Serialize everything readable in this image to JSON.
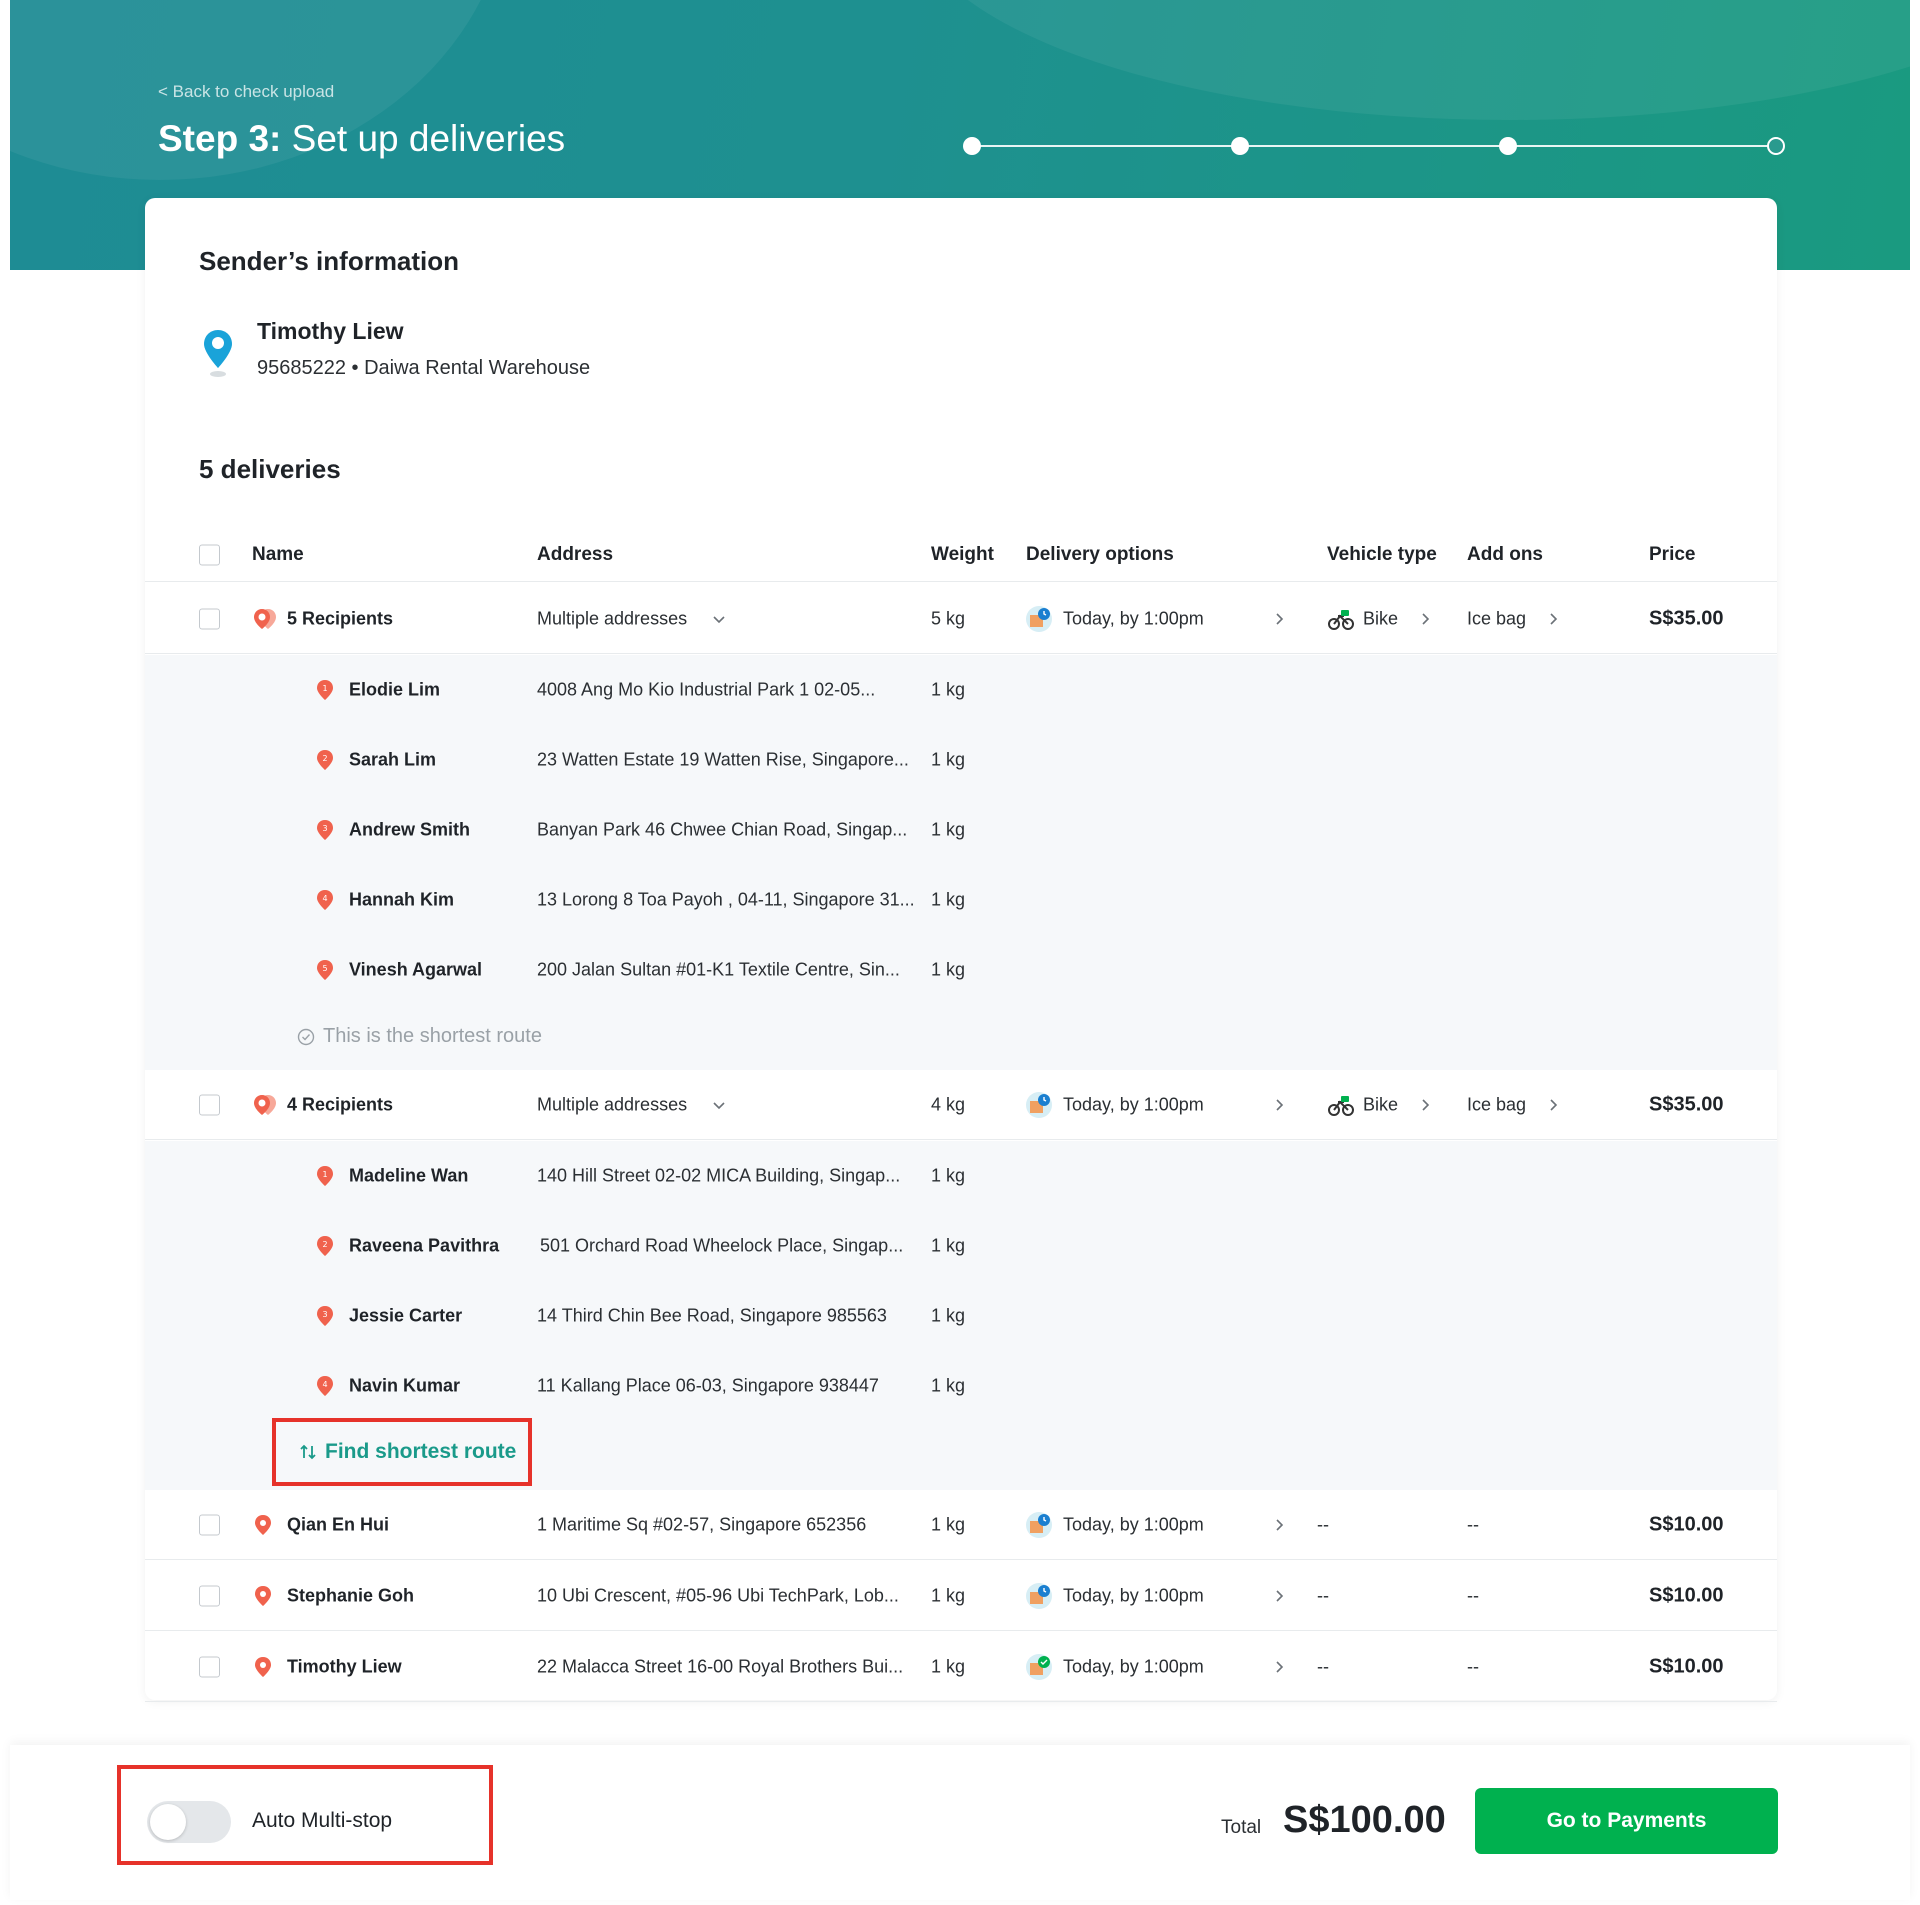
{
  "header": {
    "back_link": "< Back to check upload",
    "step_label": "Step 3:",
    "step_title": "Set up deliveries"
  },
  "sender": {
    "section_title": "Sender’s information",
    "name": "Timothy Liew",
    "details": "95685222 • Daiwa Rental Warehouse"
  },
  "deliveries": {
    "section_title": "5 deliveries",
    "columns": {
      "name": "Name",
      "address": "Address",
      "weight": "Weight",
      "delivery_options": "Delivery options",
      "vehicle_type": "Vehicle type",
      "add_ons": "Add ons",
      "price": "Price"
    },
    "groups": [
      {
        "label": "5 Recipients",
        "address": "Multiple addresses",
        "weight": "5 kg",
        "delivery_option": "Today, by 1:00pm",
        "vehicle": "Bike",
        "addon": "Ice bag",
        "price": "S$35.00",
        "stops": [
          {
            "num": "1",
            "name": "Elodie Lim",
            "address": "4008 Ang Mo Kio Industrial Park 1 02-05...",
            "weight": "1 kg"
          },
          {
            "num": "2",
            "name": "Sarah Lim",
            "address": "23 Watten Estate 19 Watten Rise, Singapore...",
            "weight": "1 kg"
          },
          {
            "num": "3",
            "name": "Andrew Smith",
            "address": "Banyan Park 46 Chwee Chian Road, Singap...",
            "weight": "1 kg"
          },
          {
            "num": "4",
            "name": "Hannah Kim",
            "address": "13 Lorong 8 Toa Payoh , 04-11, Singapore 31...",
            "weight": "1 kg"
          },
          {
            "num": "5",
            "name": "Vinesh Agarwal",
            "address": "200 Jalan Sultan #01-K1 Textile Centre, Sin...",
            "weight": "1 kg"
          }
        ],
        "route_status": "This is the shortest route"
      },
      {
        "label": "4 Recipients",
        "address": "Multiple addresses",
        "weight": "4 kg",
        "delivery_option": "Today, by 1:00pm",
        "vehicle": "Bike",
        "addon": "Ice bag",
        "price": "S$35.00",
        "stops": [
          {
            "num": "1",
            "name": "Madeline Wan",
            "address": "140 Hill Street 02-02 MICA Building, Singap...",
            "weight": "1 kg"
          },
          {
            "num": "2",
            "name": "Raveena Pavithra",
            "address": "501 Orchard Road Wheelock Place, Singap...",
            "weight": "1 kg"
          },
          {
            "num": "3",
            "name": "Jessie Carter",
            "address": "14 Third Chin Bee Road, Singapore 985563",
            "weight": "1 kg"
          },
          {
            "num": "4",
            "name": "Navin Kumar",
            "address": "11 Kallang Place 06-03, Singapore 938447",
            "weight": "1 kg"
          }
        ],
        "route_action": "Find shortest route"
      }
    ],
    "singles": [
      {
        "name": "Qian En Hui",
        "address": "1 Maritime Sq #02-57, Singapore 652356",
        "weight": "1 kg",
        "delivery_option": "Today, by 1:00pm",
        "vehicle": "--",
        "addon": "--",
        "price": "S$10.00"
      },
      {
        "name": "Stephanie Goh",
        "address": "10 Ubi Crescent, #05-96 Ubi TechPark, Lob...",
        "weight": "1 kg",
        "delivery_option": "Today, by 1:00pm",
        "vehicle": "--",
        "addon": "--",
        "price": "S$10.00"
      },
      {
        "name": "Timothy Liew",
        "address": "22 Malacca Street 16-00 Royal Brothers Bui...",
        "weight": "1 kg",
        "delivery_option": "Today, by 1:00pm",
        "vehicle": "--",
        "addon": "--",
        "price": "S$10.00"
      }
    ]
  },
  "footer": {
    "toggle_label": "Auto Multi-stop",
    "total_label": "Total",
    "total_value": "S$100.00",
    "pay_button": "Go to Payments"
  },
  "colors": {
    "banner": "#1e8c94",
    "primary_green": "#00b14f",
    "teal_link": "#1a9a8a",
    "pin_red": "#f0624d",
    "highlight_red": "#e6322a"
  }
}
